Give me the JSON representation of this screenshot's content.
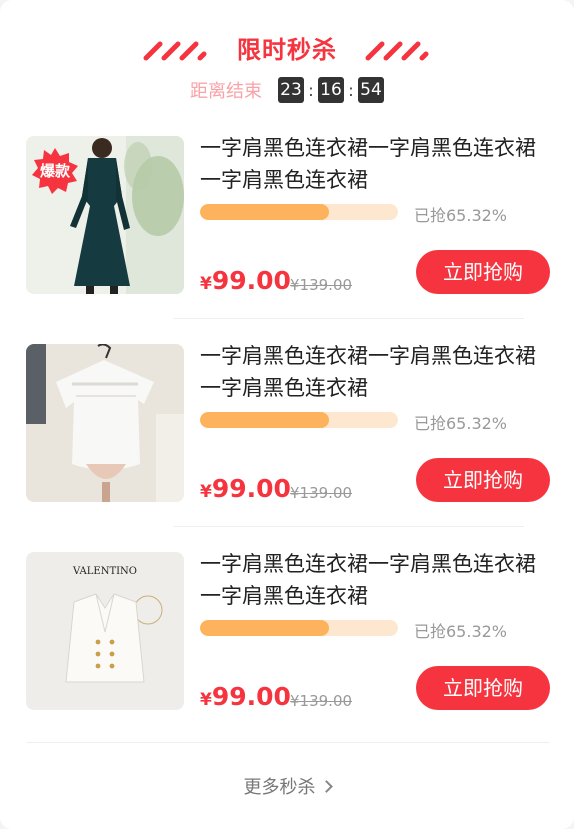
{
  "header": {
    "title": "限时秒杀",
    "countdown_label": "距离结束",
    "hours": "23",
    "minutes": "16",
    "seconds": "54",
    "separator": ":"
  },
  "items": [
    {
      "name": "一字肩黑色连衣裙一字肩黑色连衣裙一字肩黑色连衣裙",
      "progress_text": "已抢65.32%",
      "progress": 0.6532,
      "currency": "¥",
      "price": "99.00",
      "original_price": "¥139.00",
      "buy_label": "立即抢购",
      "badge": "爆款",
      "thumb_icon": "dress-photo"
    },
    {
      "name": "一字肩黑色连衣裙一字肩黑色连衣裙一字肩黑色连衣裙",
      "progress_text": "已抢65.32%",
      "progress": 0.6532,
      "currency": "¥",
      "price": "99.00",
      "original_price": "¥139.00",
      "buy_label": "立即抢购",
      "thumb_icon": "white-top-photo"
    },
    {
      "name": "一字肩黑色连衣裙一字肩黑色连衣裙一字肩黑色连衣裙",
      "progress_text": "已抢65.32%",
      "progress": 0.6532,
      "currency": "¥",
      "price": "99.00",
      "original_price": "¥139.00",
      "buy_label": "立即抢购",
      "thumb_brand": "VALENTINO",
      "thumb_icon": "white-jacket-photo"
    }
  ],
  "footer": {
    "more_label": "更多秒杀"
  },
  "colors": {
    "accent": "#f5343f",
    "progress_fill": "#fdb35d",
    "progress_track": "#fde8cf"
  }
}
